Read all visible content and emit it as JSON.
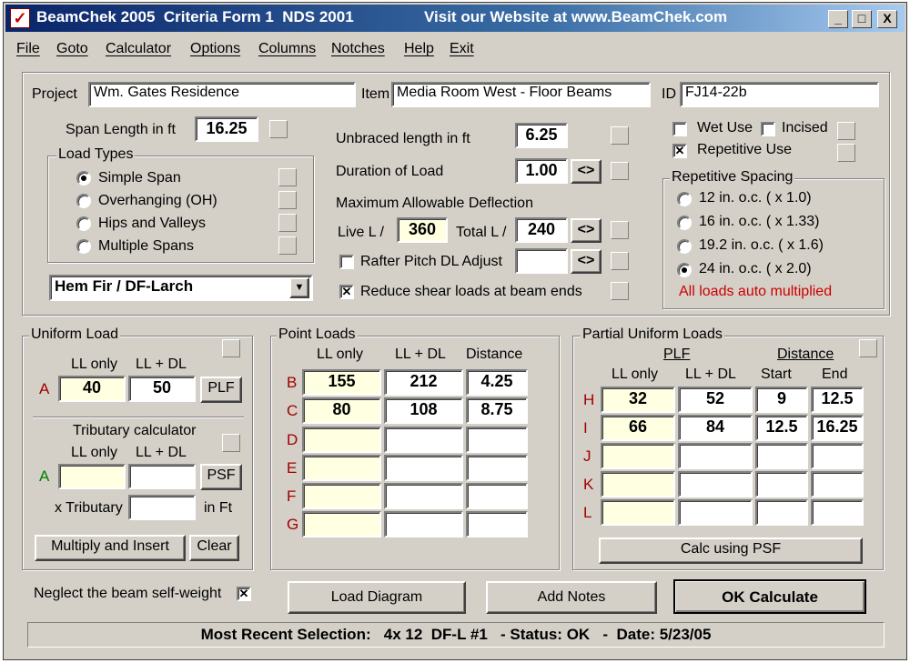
{
  "window": {
    "title": "BeamChek 2005  Criteria Form 1  NDS 2001",
    "website": "Visit our Website at www.BeamChek.com",
    "app_icon": "check-icon",
    "minimize": "_",
    "maximize": "□",
    "close": "X"
  },
  "menu": [
    "File",
    "Goto",
    "Calculator",
    "Options",
    "Columns",
    "Notches",
    "Help",
    "Exit"
  ],
  "project": {
    "project_label": "Project",
    "project_value": "Wm. Gates Residence",
    "item_label": "Item",
    "item_value": "Media Room West - Floor Beams",
    "id_label": "ID",
    "id_value": "FJ14-22b"
  },
  "span": {
    "label": "Span Length in ft",
    "value": "16.25"
  },
  "load_types": {
    "title": "Load Types",
    "options": [
      "Simple Span",
      "Overhanging (OH)",
      "Hips and Valleys",
      "Multiple Spans"
    ],
    "selected": "Simple Span"
  },
  "species": {
    "selected": "Hem Fir / DF-Larch"
  },
  "unbraced": {
    "label": "Unbraced length in ft",
    "value": "6.25"
  },
  "duration": {
    "label": "Duration of Load",
    "value": "1.00",
    "button": "<>"
  },
  "deflection": {
    "title": "Maximum Allowable Deflection",
    "live_label": "Live L /",
    "live_value": "360",
    "total_label": "Total L /",
    "total_value": "240",
    "button": "<>"
  },
  "rafter": {
    "label": "Rafter Pitch DL Adjust",
    "value": "",
    "checked": false,
    "button": "<>"
  },
  "reduce_shear": {
    "label": "Reduce shear loads at beam ends",
    "checked": true
  },
  "wet_use": {
    "label": "Wet Use",
    "checked": false
  },
  "incised": {
    "label": "Incised",
    "checked": false
  },
  "repetitive_use": {
    "label": "Repetitive Use",
    "checked": true
  },
  "repetitive_spacing": {
    "title": "Repetitive Spacing",
    "options": [
      "12 in. o.c. ( x 1.0)",
      "16 in. o.c. ( x 1.33)",
      "19.2 in. o.c. ( x 1.6)",
      "24 in. o.c. ( x 2.0)"
    ],
    "selected": "24 in. o.c. ( x 2.0)",
    "note": "All loads auto multiplied",
    "note_color": "#cc0000"
  },
  "uniform_load": {
    "title": "Uniform Load",
    "ll_label": "LL only",
    "lldl_label": "LL + DL",
    "row_label": "A",
    "ll": "40",
    "lldl": "50",
    "button": "PLF",
    "trib_title": "Tributary calculator",
    "trib_ll_label": "LL only",
    "trib_lldl_label": "LL + DL",
    "trib_row_label": "A",
    "trib_ll": "",
    "trib_lldl": "",
    "trib_button": "PSF",
    "x_trib_label": "x Tributary",
    "x_trib_value": "",
    "in_ft": "in Ft",
    "multiply_button": "Multiply and Insert",
    "clear_button": "Clear"
  },
  "point_loads": {
    "title": "Point Loads",
    "headers": [
      "LL only",
      "LL + DL",
      "Distance"
    ],
    "rows": [
      {
        "label": "B",
        "ll": "155",
        "lldl": "212",
        "dist": "4.25"
      },
      {
        "label": "C",
        "ll": "80",
        "lldl": "108",
        "dist": "8.75"
      },
      {
        "label": "D",
        "ll": "",
        "lldl": "",
        "dist": ""
      },
      {
        "label": "E",
        "ll": "",
        "lldl": "",
        "dist": ""
      },
      {
        "label": "F",
        "ll": "",
        "lldl": "",
        "dist": ""
      },
      {
        "label": "G",
        "ll": "",
        "lldl": "",
        "dist": ""
      }
    ]
  },
  "partial_loads": {
    "title": "Partial Uniform Loads",
    "plf_label": "PLF",
    "distance_label": "Distance",
    "headers": [
      "LL only",
      "LL + DL",
      "Start",
      "End"
    ],
    "rows": [
      {
        "label": "H",
        "ll": "32",
        "lldl": "52",
        "start": "9",
        "end": "12.5"
      },
      {
        "label": "I",
        "ll": "66",
        "lldl": "84",
        "start": "12.5",
        "end": "16.25"
      },
      {
        "label": "J",
        "ll": "",
        "lldl": "",
        "start": "",
        "end": ""
      },
      {
        "label": "K",
        "ll": "",
        "lldl": "",
        "start": "",
        "end": ""
      },
      {
        "label": "L",
        "ll": "",
        "lldl": "",
        "start": "",
        "end": ""
      }
    ],
    "calc_button": "Calc using PSF"
  },
  "self_weight": {
    "label": "Neglect the beam self-weight",
    "checked": true
  },
  "buttons": {
    "load_diagram": "Load Diagram",
    "add_notes": "Add Notes",
    "ok_calculate": "OK Calculate"
  },
  "status": {
    "text": "Most Recent Selection:   4x 12  DF-L #1   - Status: OK   -  Date: 5/23/05"
  },
  "colors": {
    "title_start": "#0a246a",
    "title_end": "#a6caf0",
    "row_label": "#a00000",
    "green_label": "#008000",
    "input_highlight": "#ffffe1"
  }
}
